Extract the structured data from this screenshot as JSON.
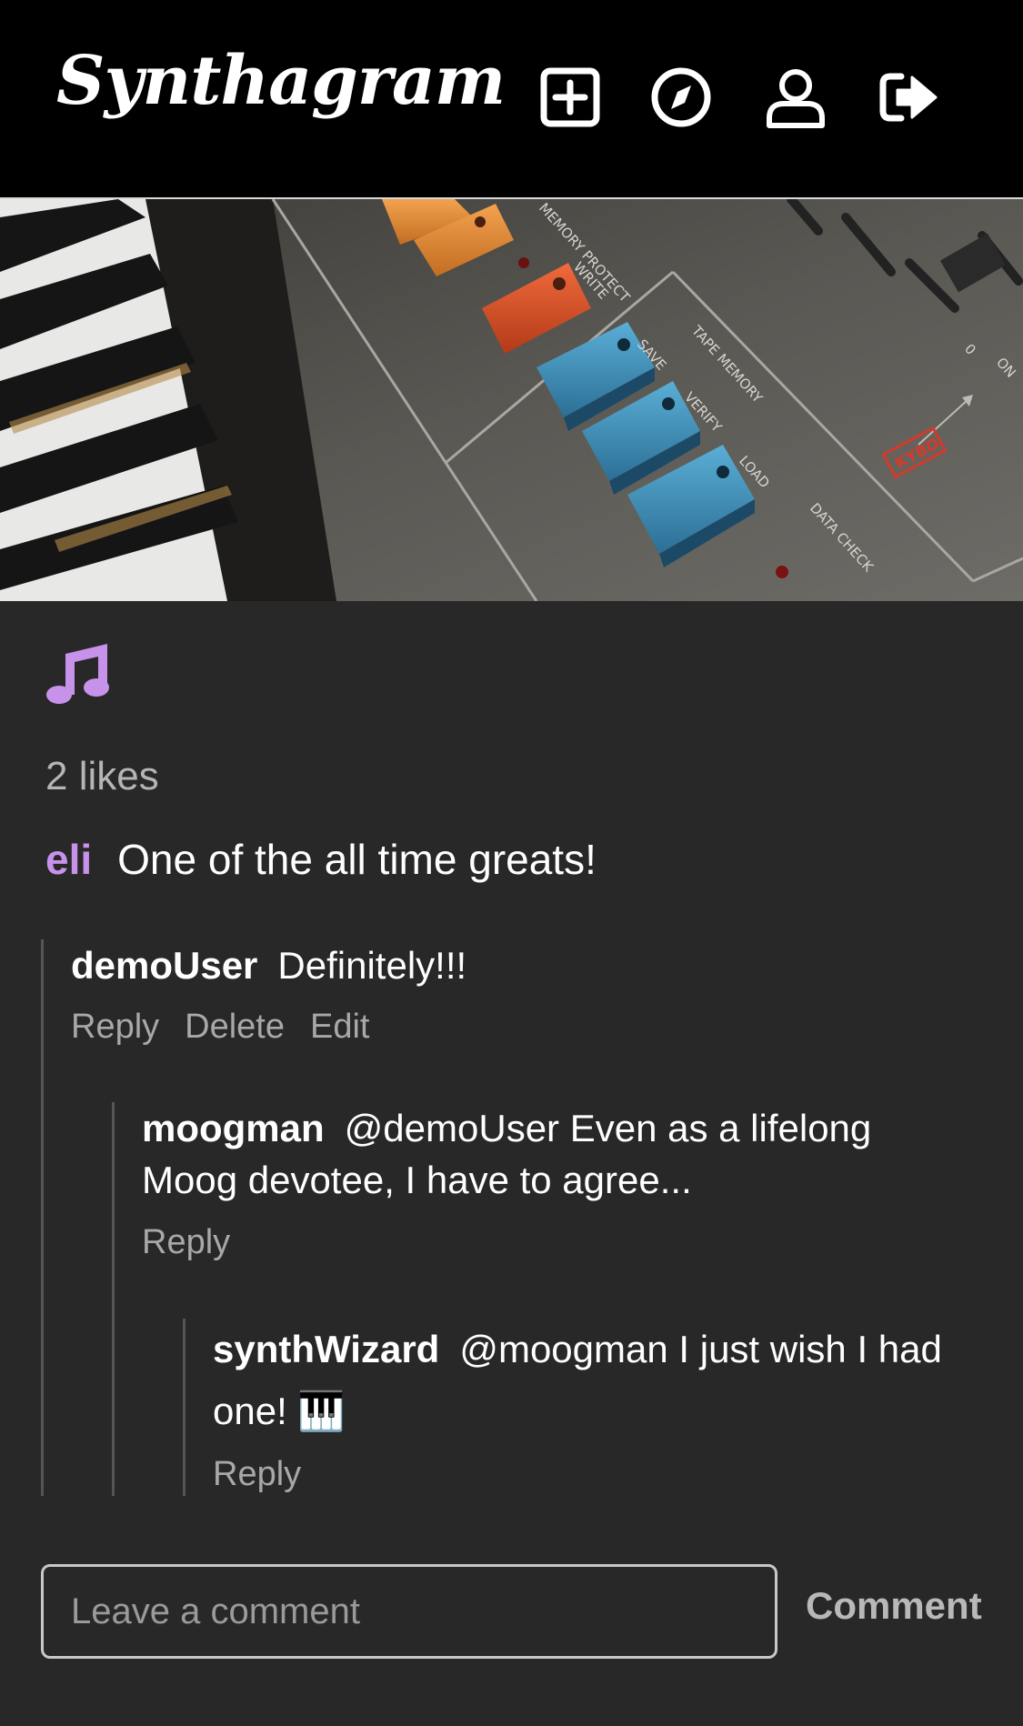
{
  "header": {
    "app_name": "Synthagram",
    "icons": [
      "new-post-icon",
      "explore-icon",
      "profile-icon",
      "logout-icon"
    ]
  },
  "post": {
    "image_text": {
      "memory_protect": "MEMORY PROTECT",
      "write": "WRITE",
      "tape_memory": "TAPE MEMORY",
      "save": "SAVE",
      "verify": "VERIFY",
      "load": "LOAD",
      "data_check": "DATA CHECK",
      "kybd": "KYBD",
      "zero": "0",
      "on": "ON"
    },
    "likes": "2 likes",
    "author": "eli",
    "caption": "One of the all time greats!"
  },
  "comments": [
    {
      "user": "demoUser",
      "text": "Definitely!!!",
      "actions": [
        "Reply",
        "Delete",
        "Edit"
      ]
    },
    {
      "user": "moogman",
      "text": "@demoUser Even as a lifelong Moog devotee, I have to agree...",
      "actions": [
        "Reply"
      ]
    },
    {
      "user": "synthWizard",
      "text": "@moogman I just wish I had one! 🎹",
      "actions": [
        "Reply"
      ]
    }
  ],
  "form": {
    "placeholder": "Leave a comment",
    "submit_label": "Comment"
  },
  "colors": {
    "background": "#282829",
    "header": "#000000",
    "accent": "#c792ea",
    "muted": "#a8a8a8"
  }
}
